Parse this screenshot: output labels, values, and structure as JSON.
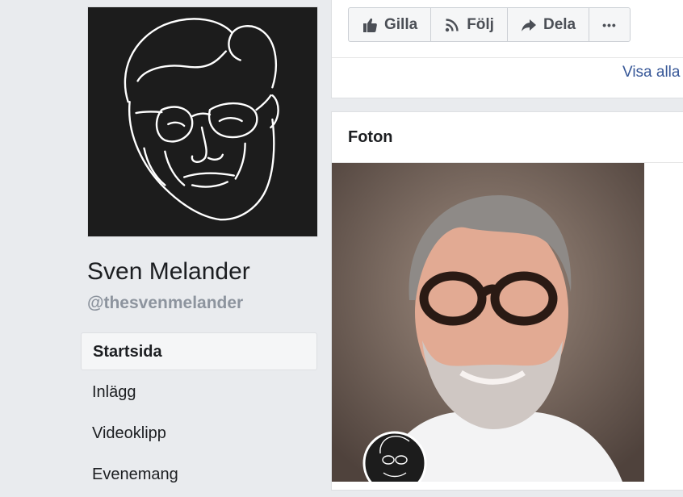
{
  "profile": {
    "name": "Sven Melander",
    "handle": "@thesvenmelander",
    "avatar_icon": "line-art-face-portrait"
  },
  "nav": {
    "items": [
      {
        "label": "Startsida",
        "active": true
      },
      {
        "label": "Inlägg",
        "active": false
      },
      {
        "label": "Videoklipp",
        "active": false
      },
      {
        "label": "Evenemang",
        "active": false
      }
    ]
  },
  "actions": {
    "like_label": "Gilla",
    "follow_label": "Följ",
    "share_label": "Dela",
    "more_label": "•••",
    "icons": [
      "thumbs-up-icon",
      "rss-icon",
      "share-arrow-icon",
      "more-dots-icon"
    ]
  },
  "top_card": {
    "see_all_label": "Visa alla"
  },
  "photos": {
    "title": "Foton",
    "main_photo": "portrait-photo"
  },
  "colors": {
    "page_bg": "#e9ebee",
    "card_bg": "#ffffff",
    "link": "#385898",
    "muted": "#8d949e",
    "text": "#1c1e21"
  }
}
